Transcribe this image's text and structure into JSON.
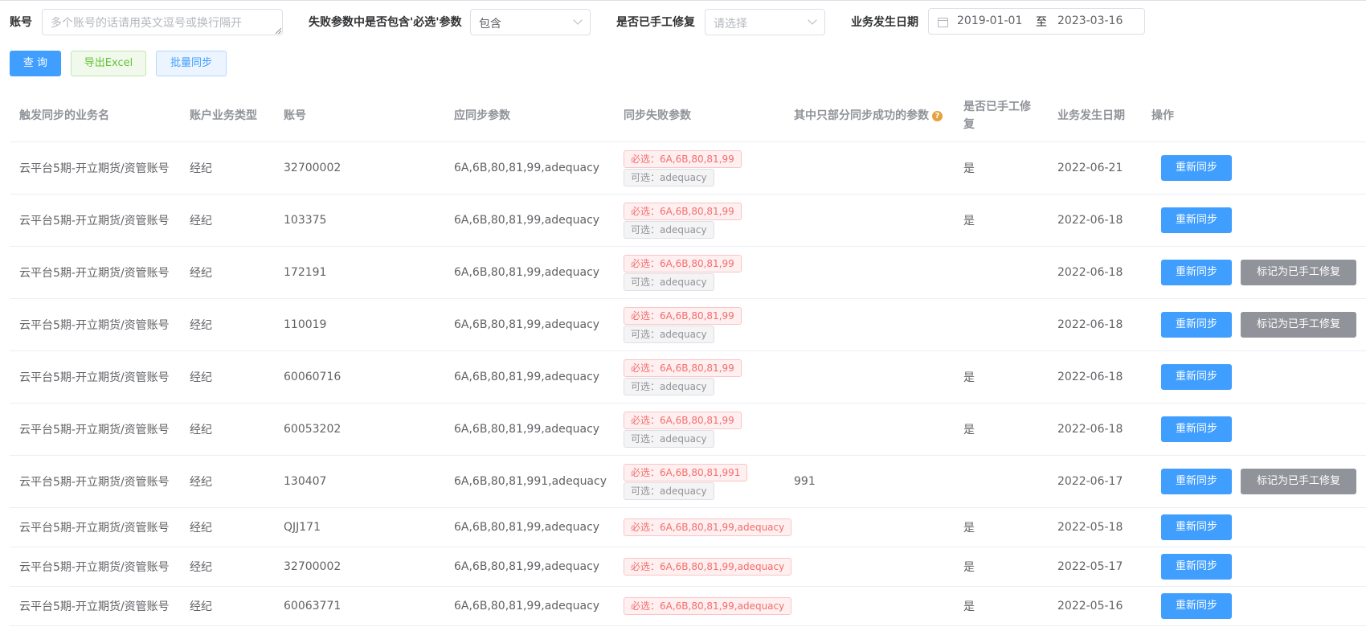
{
  "filters": {
    "account_label": "账号",
    "account_placeholder": "多个账号的话请用英文逗号或换行隔开",
    "fail_label": "失败参数中是否包含'必选'参数",
    "fail_value": "包含",
    "manual_label": "是否已手工修复",
    "manual_placeholder": "请选择",
    "date_label": "业务发生日期",
    "date_start": "2019-01-01",
    "date_sep": "至",
    "date_end": "2023-03-16"
  },
  "actions": {
    "query": "查 询",
    "export": "导出Excel",
    "batch": "批量同步"
  },
  "table": {
    "headers": {
      "biz_name": "触发同步的业务名",
      "acct_type": "账户业务类型",
      "account": "账号",
      "should_sync": "应同步参数",
      "failed": "同步失败参数",
      "partial": "其中只部分同步成功的参数",
      "manual_fixed": "是否已手工修复",
      "biz_date": "业务发生日期",
      "ops": "操作"
    },
    "partial_help_icon": "question-circle-icon",
    "rows": [
      {
        "biz_name": "云平台5期-开立期货/资管账号",
        "acct_type": "经纪",
        "account": "32700002",
        "should_sync": "6A,6B,80,81,99,adequacy",
        "required": "必选：6A,6B,80,81,99",
        "optional": "可选：adequacy",
        "partial": "",
        "fixed": "是",
        "date": "2022-06-21",
        "resync": "重新同步",
        "mark": ""
      },
      {
        "biz_name": "云平台5期-开立期货/资管账号",
        "acct_type": "经纪",
        "account": "103375",
        "should_sync": "6A,6B,80,81,99,adequacy",
        "required": "必选：6A,6B,80,81,99",
        "optional": "可选：adequacy",
        "partial": "",
        "fixed": "是",
        "date": "2022-06-18",
        "resync": "重新同步",
        "mark": ""
      },
      {
        "biz_name": "云平台5期-开立期货/资管账号",
        "acct_type": "经纪",
        "account": "172191",
        "should_sync": "6A,6B,80,81,99,adequacy",
        "required": "必选：6A,6B,80,81,99",
        "optional": "可选：adequacy",
        "partial": "",
        "fixed": "",
        "date": "2022-06-18",
        "resync": "重新同步",
        "mark": "标记为已手工修复"
      },
      {
        "biz_name": "云平台5期-开立期货/资管账号",
        "acct_type": "经纪",
        "account": "110019",
        "should_sync": "6A,6B,80,81,99,adequacy",
        "required": "必选：6A,6B,80,81,99",
        "optional": "可选：adequacy",
        "partial": "",
        "fixed": "",
        "date": "2022-06-18",
        "resync": "重新同步",
        "mark": "标记为已手工修复"
      },
      {
        "biz_name": "云平台5期-开立期货/资管账号",
        "acct_type": "经纪",
        "account": "60060716",
        "should_sync": "6A,6B,80,81,99,adequacy",
        "required": "必选：6A,6B,80,81,99",
        "optional": "可选：adequacy",
        "partial": "",
        "fixed": "是",
        "date": "2022-06-18",
        "resync": "重新同步",
        "mark": ""
      },
      {
        "biz_name": "云平台5期-开立期货/资管账号",
        "acct_type": "经纪",
        "account": "60053202",
        "should_sync": "6A,6B,80,81,99,adequacy",
        "required": "必选：6A,6B,80,81,99",
        "optional": "可选：adequacy",
        "partial": "",
        "fixed": "是",
        "date": "2022-06-18",
        "resync": "重新同步",
        "mark": ""
      },
      {
        "biz_name": "云平台5期-开立期货/资管账号",
        "acct_type": "经纪",
        "account": "130407",
        "should_sync": "6A,6B,80,81,991,adequacy",
        "required": "必选：6A,6B,80,81,991",
        "optional": "可选：adequacy",
        "partial": "991",
        "fixed": "",
        "date": "2022-06-17",
        "resync": "重新同步",
        "mark": "标记为已手工修复"
      },
      {
        "biz_name": "云平台5期-开立期货/资管账号",
        "acct_type": "经纪",
        "account": "QJJ171",
        "should_sync": "6A,6B,80,81,99,adequacy",
        "required": "必选：6A,6B,80,81,99,adequacy",
        "optional": "",
        "partial": "",
        "fixed": "是",
        "date": "2022-05-18",
        "resync": "重新同步",
        "mark": ""
      },
      {
        "biz_name": "云平台5期-开立期货/资管账号",
        "acct_type": "经纪",
        "account": "32700002",
        "should_sync": "6A,6B,80,81,99,adequacy",
        "required": "必选：6A,6B,80,81,99,adequacy",
        "optional": "",
        "partial": "",
        "fixed": "是",
        "date": "2022-05-17",
        "resync": "重新同步",
        "mark": ""
      },
      {
        "biz_name": "云平台5期-开立期货/资管账号",
        "acct_type": "经纪",
        "account": "60063771",
        "should_sync": "6A,6B,80,81,99,adequacy",
        "required": "必选：6A,6B,80,81,99,adequacy",
        "optional": "",
        "partial": "",
        "fixed": "是",
        "date": "2022-05-16",
        "resync": "重新同步",
        "mark": ""
      }
    ]
  }
}
